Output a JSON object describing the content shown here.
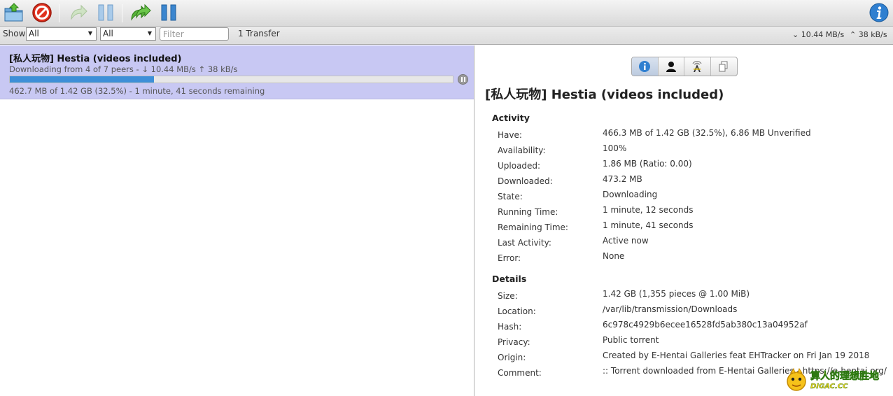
{
  "toolbar": {
    "icons": [
      "open-folder-icon",
      "remove-icon",
      "start-icon",
      "pause-icon",
      "start-all-icon",
      "pause-all-icon",
      "info-icon"
    ]
  },
  "filterbar": {
    "show_label": "Show",
    "state_filter": "All",
    "tracker_filter": "All",
    "filter_placeholder": "Filter",
    "transfer_count": "1 Transfer",
    "download_speed": "10.44 MB/s",
    "upload_speed": "38 kB/s"
  },
  "torrent": {
    "name": "[私人玩物] Hestia (videos included)",
    "peers": "Downloading from 4 of 7 peers - ↓ 10.44 MB/s ↑ 38 kB/s",
    "progress_fraction": 0.325,
    "progress_text": "462.7 MB of 1.42 GB (32.5%) - 1 minute, 41 seconds remaining"
  },
  "inspector": {
    "title": "[私人玩物] Hestia (videos included)",
    "activity_header": "Activity",
    "activity": [
      {
        "key": "Have:",
        "value": "466.3 MB of 1.42 GB (32.5%), 6.86 MB Unverified"
      },
      {
        "key": "Availability:",
        "value": "100%"
      },
      {
        "key": "Uploaded:",
        "value": "1.86 MB (Ratio: 0.00)"
      },
      {
        "key": "Downloaded:",
        "value": "473.2 MB"
      },
      {
        "key": "State:",
        "value": "Downloading"
      },
      {
        "key": "Running Time:",
        "value": "1 minute, 12 seconds"
      },
      {
        "key": "Remaining Time:",
        "value": "1 minute, 41 seconds"
      },
      {
        "key": "Last Activity:",
        "value": "Active now"
      },
      {
        "key": "Error:",
        "value": "None"
      }
    ],
    "details_header": "Details",
    "details": [
      {
        "key": "Size:",
        "value": "1.42 GB (1,355 pieces @ 1.00 MiB)"
      },
      {
        "key": "Location:",
        "value": "/var/lib/transmission/Downloads"
      },
      {
        "key": "Hash:",
        "value": "6c978c4929b6ecee16528fd5ab380c13a04952af"
      },
      {
        "key": "Privacy:",
        "value": "Public torrent"
      },
      {
        "key": "Origin:",
        "value": "Created by E-Hentai Galleries feat EHTracker on Fri Jan 19 2018"
      },
      {
        "key": "Comment:",
        "value": ":: Torrent downloaded from E-Hentai Galleries - https://e-hentai.org/"
      }
    ]
  },
  "watermark": {
    "line1": "算人的理想胜地",
    "line2": "DIGAC.CC"
  }
}
